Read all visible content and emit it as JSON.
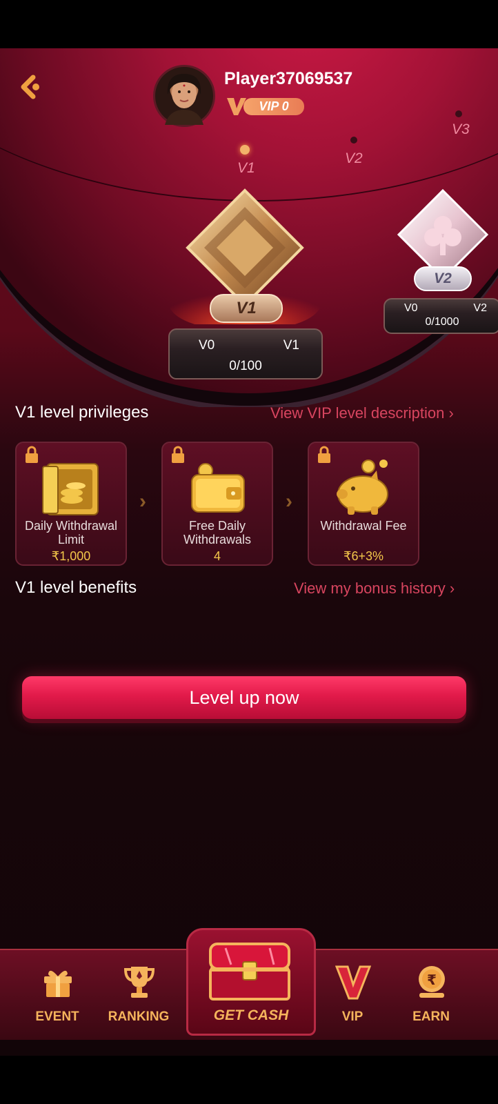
{
  "header": {
    "player_name": "Player37069537",
    "vip_badge": "VIP 0"
  },
  "levels": {
    "v1": "V1",
    "v2": "V2",
    "v3": "V3"
  },
  "trophies": [
    {
      "plate": "V1",
      "from": "V0",
      "to": "V1",
      "count": "0/100"
    },
    {
      "plate": "V2",
      "from": "V0",
      "to": "V2",
      "count": "0/1000"
    }
  ],
  "privileges": {
    "title": "V1 level privileges",
    "link": "View VIP level description",
    "cards": [
      {
        "label": "Daily Withdrawal Limit",
        "value": "₹1,000",
        "icon": "safe-icon"
      },
      {
        "label": "Free Daily Withdrawals",
        "value": "4",
        "icon": "wallet-icon"
      },
      {
        "label": "Withdrawal Fee",
        "value": "₹6+3%",
        "icon": "piggy-bank-icon"
      }
    ]
  },
  "benefits": {
    "title": "V1 level benefits",
    "link": "View my bonus history"
  },
  "cta": "Level up now",
  "nav": {
    "event": "EVENT",
    "ranking": "RANKING",
    "get_cash": "GET CASH",
    "vip": "VIP",
    "earn": "EARN"
  },
  "colors": {
    "accent": "#e21a4a",
    "gold": "#f3c64a",
    "link": "#d8455f"
  }
}
